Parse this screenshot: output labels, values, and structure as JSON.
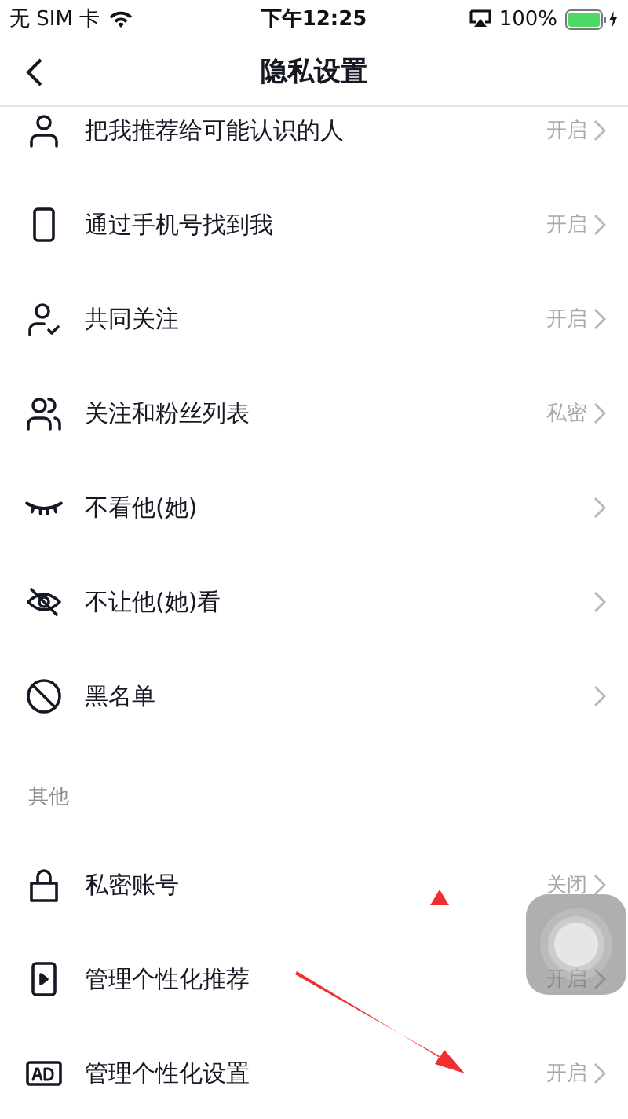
{
  "status_bar": {
    "carrier": "无 SIM 卡",
    "time": "下午12:25",
    "battery": "100%"
  },
  "nav": {
    "title": "隐私设置"
  },
  "sections": [
    {
      "items": [
        {
          "kind": "person",
          "label": "把我推荐给可能认识的人",
          "value": "开启"
        },
        {
          "kind": "phone",
          "label": "通过手机号找到我",
          "value": "开启"
        },
        {
          "kind": "person-check",
          "label": "共同关注",
          "value": "开启"
        },
        {
          "kind": "people",
          "label": "关注和粉丝列表",
          "value": "私密"
        },
        {
          "kind": "eye-closed",
          "label": "不看他(她)"
        },
        {
          "kind": "eye-off",
          "label": "不让他(她)看"
        },
        {
          "kind": "block",
          "label": "黑名单"
        }
      ]
    },
    {
      "title": "其他",
      "items": [
        {
          "kind": "lock",
          "label": "私密账号",
          "value": "关闭"
        },
        {
          "kind": "video",
          "label": "管理个性化推荐",
          "value": "开启"
        },
        {
          "kind": "ad",
          "label": "管理个性化设置",
          "value": "开启"
        }
      ]
    }
  ]
}
